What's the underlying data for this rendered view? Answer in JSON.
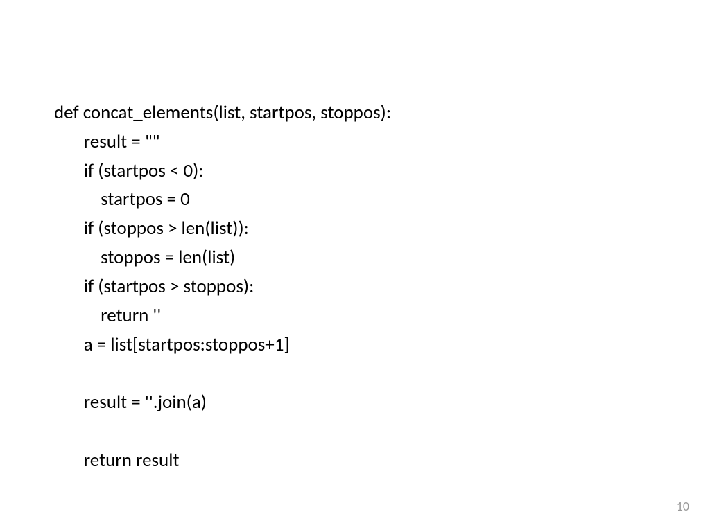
{
  "code": {
    "line1": "def concat_elements(list, startpos, stoppos):",
    "line2": "       result = \"\"",
    "line3": "       if (startpos < 0):",
    "line4": "           startpos = 0",
    "line5": "       if (stoppos > len(list)):",
    "line6": "           stoppos = len(list)",
    "line7": "       if (startpos > stoppos):",
    "line8": "           return ''",
    "line9": "       a = list[startpos:stoppos+1]",
    "line10": "",
    "line11": "       result = ''.join(a)",
    "line12": "",
    "line13": "       return result"
  },
  "pageNumber": "10"
}
